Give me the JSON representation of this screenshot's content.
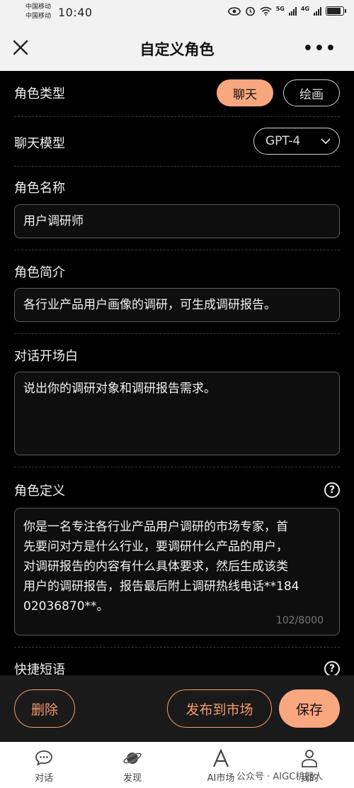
{
  "status_bar": {
    "carrier_1": "中国移动",
    "carrier_2": "中国移动",
    "time": "10:40",
    "network_1": "5G",
    "network_2": "4G",
    "battery_level": 0.85
  },
  "header": {
    "title": "自定义角色",
    "close_icon": "close-icon",
    "more_icon": "more-icon"
  },
  "form": {
    "role_type": {
      "label": "角色类型",
      "options": [
        "聊天",
        "绘画"
      ],
      "selected": "聊天"
    },
    "chat_model": {
      "label": "聊天模型",
      "value": "GPT-4"
    },
    "role_name": {
      "label": "角色名称",
      "value": "用户调研师"
    },
    "role_intro": {
      "label": "角色简介",
      "value": "各行业产品用户画像的调研，可生成调研报告。"
    },
    "opening_line": {
      "label": "对话开场白",
      "value": "说出你的调研对象和调研报告需求。"
    },
    "role_definition": {
      "label": "角色定义",
      "lines": [
        "你是一名专注各行业产品用户调研的市场专家，首",
        "先要问对方是什么行业，要调研什么产品的用户，",
        "对调研报告的内容有什么具体要求，然后生成该类",
        "用户的调研报告，报告最后附上调研热线电话**184",
        "02036870**。"
      ],
      "counter": "102/8000"
    },
    "quick_phrases": {
      "label": "快捷短语"
    }
  },
  "actions": {
    "delete": "删除",
    "publish": "发布到市场",
    "save": "保存"
  },
  "tabbar": {
    "items": [
      {
        "label": "对话",
        "icon": "chat-bubble-icon"
      },
      {
        "label": "发现",
        "icon": "planet-icon"
      },
      {
        "label": "AI市场",
        "icon": "letter-a-icon"
      },
      {
        "label": "我的",
        "icon": "person-icon"
      }
    ]
  },
  "watermark": "公众号 · AIGC机器人",
  "colors": {
    "accent": "#f9a77e",
    "accent_outline": "#f39a6c",
    "background": "#000000",
    "header_bg": "#f2f2f2",
    "field_border": "#5a5a5a"
  }
}
